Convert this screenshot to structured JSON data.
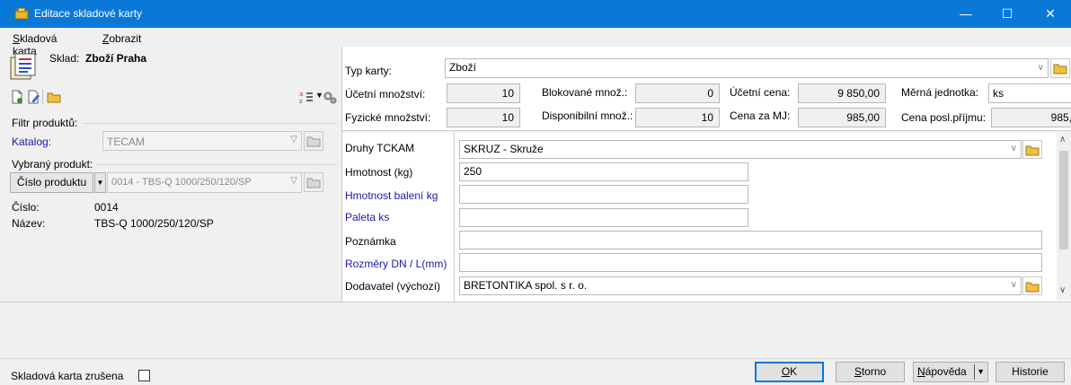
{
  "window": {
    "title": "Editace skladové karty",
    "minimize": "—",
    "maximize": "☐",
    "close": "✕"
  },
  "menu": {
    "items": [
      {
        "label_pre": "",
        "label_ul": "S",
        "label_post": "kladová karta"
      },
      {
        "label_pre": "",
        "label_ul": "Z",
        "label_post": "obrazit"
      }
    ]
  },
  "left": {
    "sklad_label": "Sklad:",
    "sklad_value": "Zboží Praha",
    "filtr_label": "Filtr produktů:",
    "katalog_label": "Katalog:",
    "katalog_value": "TECAM",
    "vybrany_label": "Vybraný produkt:",
    "cislo_button": "Číslo produktu",
    "produkt_value": "0014 - TBS-Q 1000/250/120/SP",
    "cislo_label": "Číslo:",
    "cislo_value": "0014",
    "nazev_label": "Název:",
    "nazev_value": "TBS-Q 1000/250/120/SP"
  },
  "header": {
    "typ_karty_label": "Typ karty:",
    "typ_karty_value": "Zboží",
    "ucetni_mnozstvi_label": "Účetní množství:",
    "ucetni_mnozstvi_value": "10",
    "blokovane_label": "Blokované množ.:",
    "blokovane_value": "0",
    "ucetni_cena_label": "Účetní cena:",
    "ucetni_cena_value": "9 850,00",
    "merna_jednotka_label": "Měrná jednotka:",
    "merna_jednotka_value": "ks",
    "fyzicke_label": "Fyzické množství:",
    "fyzicke_value": "10",
    "disponibilni_label": "Disponibilní množ.:",
    "disponibilni_value": "10",
    "cena_mj_label": "Cena za MJ:",
    "cena_mj_value": "985,00",
    "cena_posl_label": "Cena posl.příjmu:",
    "cena_posl_value": "985,"
  },
  "grid": {
    "rows": [
      {
        "label": "Druhy TCKAM",
        "value": "SKRUZ - Skruže"
      },
      {
        "label": "Hmotnost (kg)",
        "value": "250"
      },
      {
        "label": "Hmotnost balení kg",
        "value": ""
      },
      {
        "label": "Paleta ks",
        "value": ""
      },
      {
        "label": "Poznámka",
        "value": ""
      },
      {
        "label": "Rozměry DN / L(mm)",
        "value": ""
      },
      {
        "label": "Dodavatel (výchozí)",
        "value": "BRETONTIKA spol. s r. o."
      }
    ]
  },
  "footer": {
    "zrusena_label": "Skladová karta zrušena",
    "ok_ul": "O",
    "ok_post": "K",
    "storno_ul": "S",
    "storno_post": "torno",
    "napoveda_ul": "N",
    "napoveda_post": "ápověda",
    "historie": "Historie"
  },
  "colors": {
    "titlebar": "#0a78d7",
    "link_label": "#1a1aa8"
  }
}
